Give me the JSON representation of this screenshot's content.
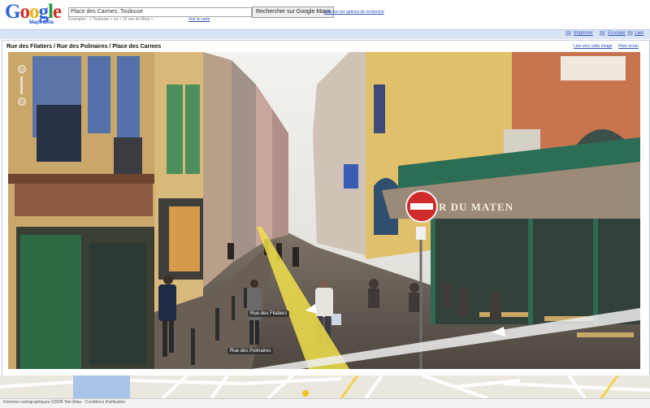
{
  "header": {
    "logo_letters": [
      "G",
      "o",
      "o",
      "g",
      "l",
      "e"
    ],
    "logo_sub": "Maps Beta",
    "search_value": "Place des Carmes, Toulouse",
    "search_button": "Rechercher sur Google Maps",
    "search_options_link": "Afficher les options de recherche",
    "tip_text": "Exemples : « Toulouse » ou « 10 rue de Metz »",
    "alt_link": "Voir la carte"
  },
  "rule": {
    "print_link": "Imprimer",
    "send_link": "Envoyer",
    "link_link": "Lien"
  },
  "panel": {
    "address": "Rue des Filatiers / Rue des Polinaires / Place des Carmes",
    "links": [
      "Lien vers cette image",
      "Plein écran"
    ]
  },
  "street": {
    "labels": {
      "filatiers": "Rue des Filatiers",
      "polinaires": "Rue des Polinaires"
    },
    "sign": "R DU MATEN"
  },
  "status": {
    "text": "Données cartographiques ©2008 Tele Atlas - Conditions d'utilisation"
  },
  "colors": {
    "accent": "#2a4fbd",
    "rule_bg": "#d9e3f6",
    "nav_line": "#f2e04a"
  }
}
